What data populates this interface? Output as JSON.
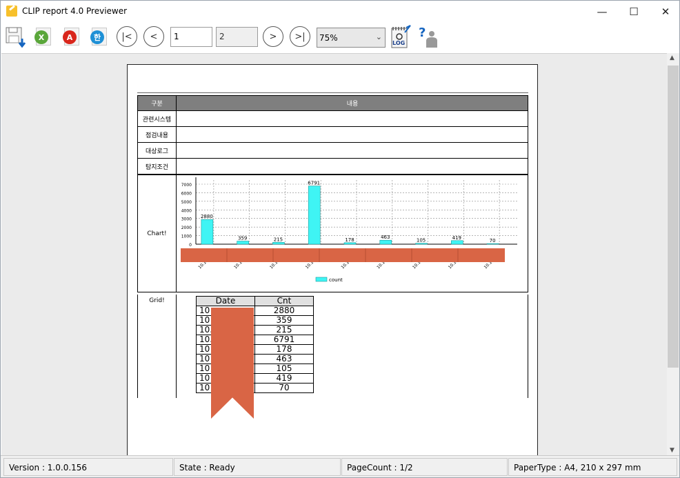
{
  "window": {
    "title": "CLIP report 4.0 Previewer",
    "minimize": "—",
    "maximize": "☐",
    "close": "✕"
  },
  "toolbar": {
    "save_icon": "save-download-icon",
    "excel_icon": "excel-export-icon",
    "pdf_icon": "pdf-export-icon",
    "hwp_icon": "hwp-export-icon",
    "first_glyph": "|<",
    "prev_glyph": "<",
    "current_page": "1",
    "total_pages": "2",
    "next_glyph": ">",
    "last_glyph": ">|",
    "zoom": "75%",
    "log_label": "LOG",
    "help_icon": "help-icon"
  },
  "report": {
    "header_label": "구분",
    "header_content": "내용",
    "rows": [
      {
        "label": "관련시스템"
      },
      {
        "label": "점검내용"
      },
      {
        "label": "대상로그"
      },
      {
        "label": "탐지조건"
      }
    ],
    "chart_label": "Chart!",
    "grid_label": "Grid!"
  },
  "chart_data": {
    "type": "bar",
    "categories": [
      "10.1",
      "10.1",
      "10.10",
      "10.10",
      "10.1",
      "10.1",
      "10.1",
      "10.1",
      "10.1"
    ],
    "series": [
      {
        "name": "count",
        "values": [
          2880,
          359,
          215,
          6791,
          178,
          463,
          105,
          419,
          70
        ]
      }
    ],
    "y_ticks": [
      "0",
      "1000",
      "2000",
      "3000",
      "4000",
      "5000",
      "6000",
      "7000"
    ],
    "ylim": [
      0,
      7000
    ],
    "grid": true,
    "legend": "bottom",
    "bar_color": "#3ff4f4"
  },
  "grid": {
    "headers": [
      "Date",
      "Cnt"
    ],
    "rows": [
      {
        "date": "10",
        "cnt": "2880"
      },
      {
        "date": "10",
        "cnt": "359"
      },
      {
        "date": "10.",
        "cnt": "215"
      },
      {
        "date": "10.",
        "cnt": "6791"
      },
      {
        "date": "10",
        "cnt": "178"
      },
      {
        "date": "10",
        "cnt": "463"
      },
      {
        "date": "10",
        "cnt": "105"
      },
      {
        "date": "10",
        "cnt": "419"
      },
      {
        "date": "10",
        "cnt": "70"
      }
    ]
  },
  "status": {
    "version": "Version : 1.0.0.156",
    "state": "State : Ready",
    "page_count": "PageCount : 1/2",
    "paper_type": "PaperType : A4, 210 x 297 mm"
  }
}
